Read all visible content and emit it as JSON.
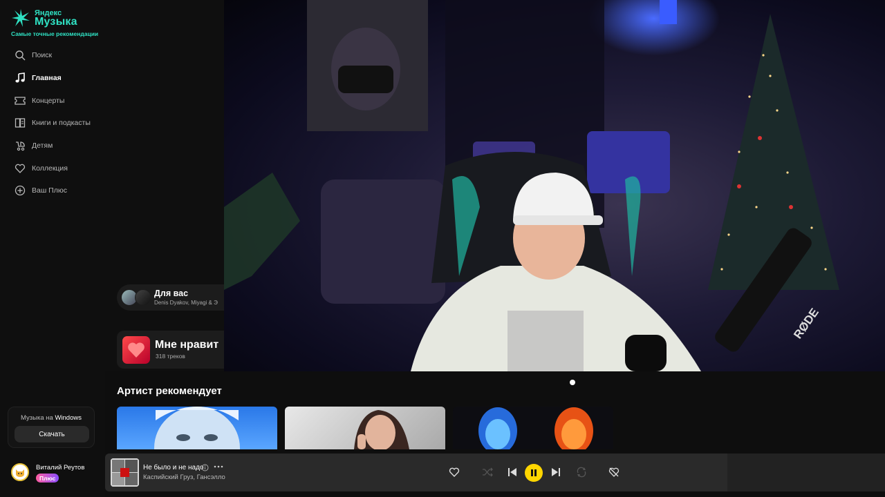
{
  "logo": {
    "brand": "Яндекс",
    "title": "Музыка",
    "tagline": "Самые точные рекомендации"
  },
  "nav": [
    {
      "label": "Поиск",
      "icon": "search-icon"
    },
    {
      "label": "Главная",
      "icon": "music-note-icon",
      "active": true
    },
    {
      "label": "Концерты",
      "icon": "ticket-icon"
    },
    {
      "label": "Книги и подкасты",
      "icon": "book-icon"
    },
    {
      "label": "Детям",
      "icon": "stroller-icon"
    },
    {
      "label": "Коллекция",
      "icon": "heart-icon"
    },
    {
      "label": "Ваш Плюс",
      "icon": "plus-circle-icon"
    }
  ],
  "download": {
    "text": "Музыка на",
    "platform": "Windows",
    "button": "Скачать"
  },
  "user": {
    "name": "Виталий Реутов",
    "badge": "Плюс"
  },
  "for_you": {
    "title": "Для вас",
    "subtitle": "Denis Dyakov, Miyagi & Э"
  },
  "liked": {
    "title": "Мне нравит",
    "count": "318 треков"
  },
  "section": {
    "title": "Артист рекомендует"
  },
  "player": {
    "title": "Не было и не надо",
    "artists": "Каспийский Груз, Гансэлло"
  },
  "colors": {
    "accent": "#2fe1c3",
    "play": "#ffd600",
    "like": "#ff2f4f"
  }
}
